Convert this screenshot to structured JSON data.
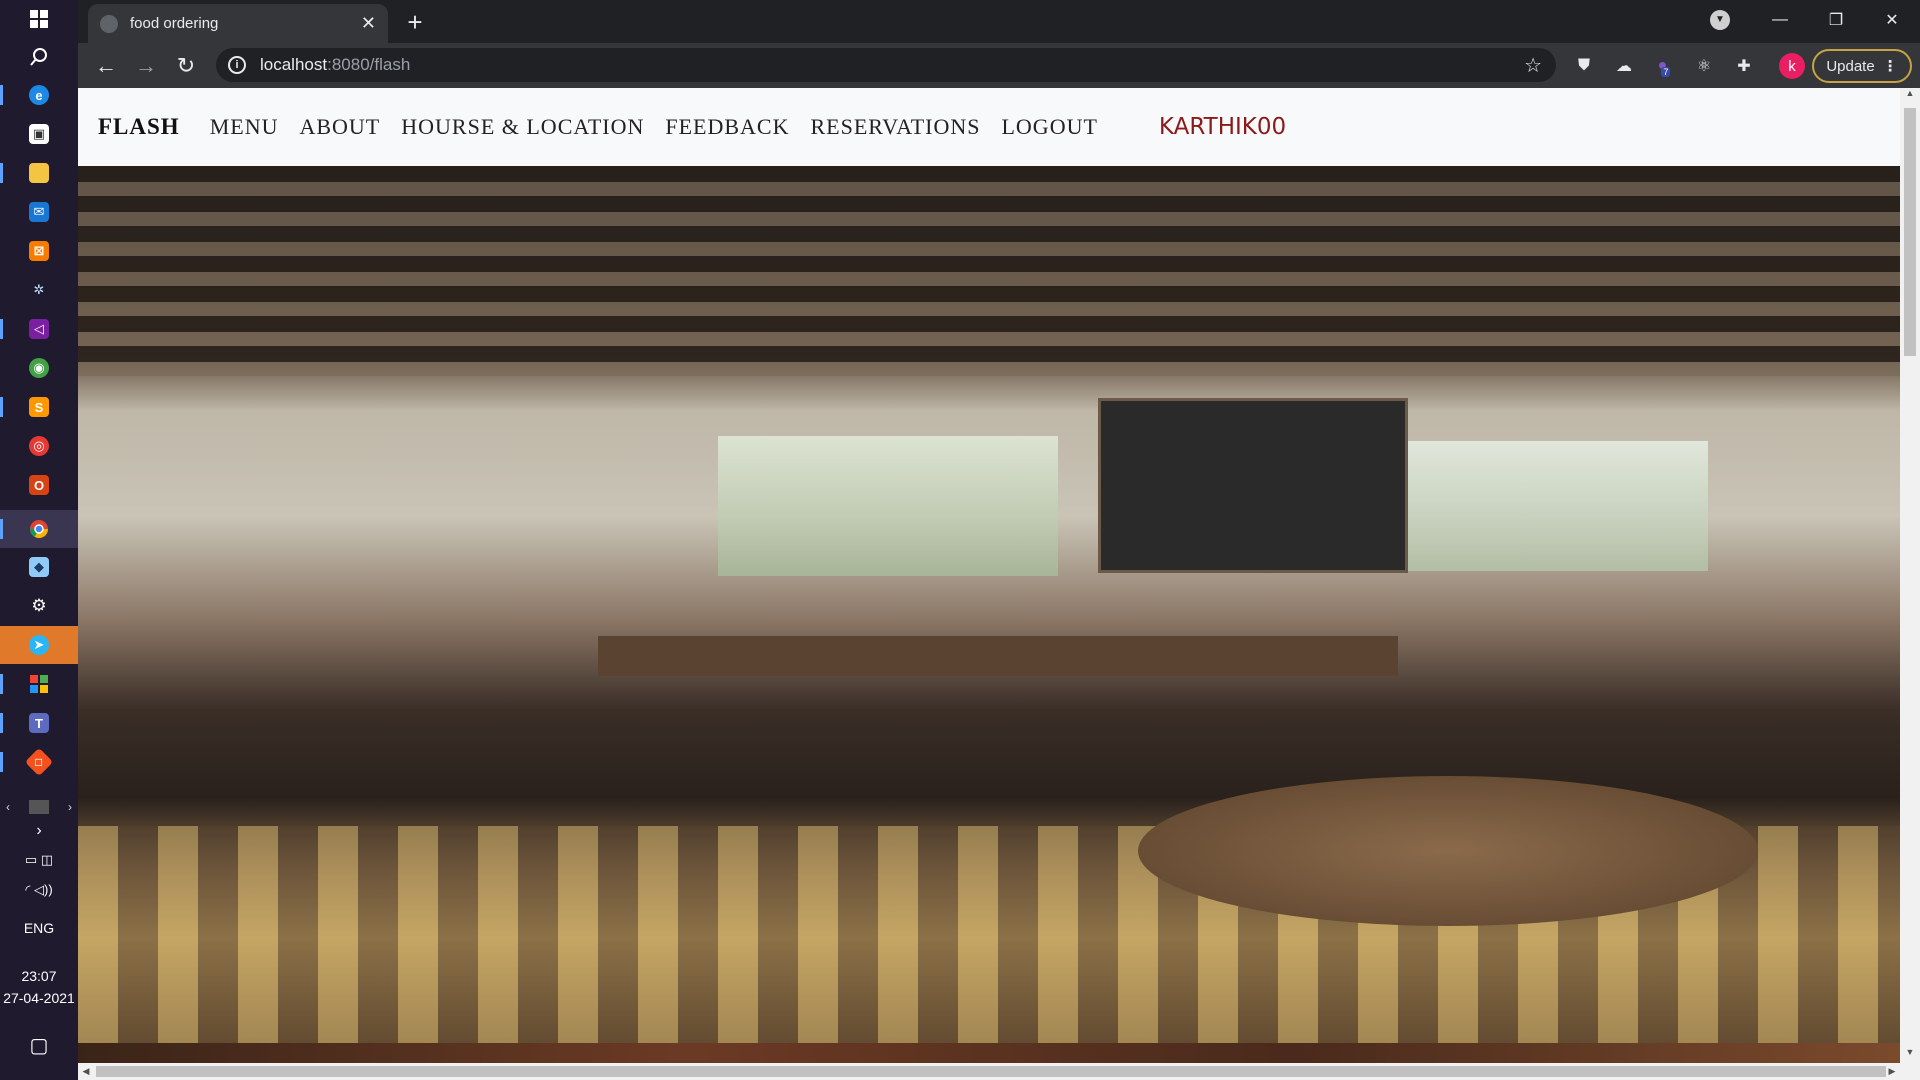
{
  "browser": {
    "tab_title": "food ordering",
    "new_tab_label": "+",
    "url_host": "localhost",
    "url_path": ":8080/flash",
    "profile_initial": "k",
    "update_label": "Update",
    "extension_badge": "7"
  },
  "site": {
    "brand": "FLASH",
    "nav": [
      "MENU",
      "ABOUT",
      "HOURSE & LOCATION",
      "FEEDBACK",
      "RESERVATIONS",
      "LOGOUT"
    ],
    "user": "KARTHIK00"
  },
  "system": {
    "language": "ENG",
    "time": "23:07",
    "date": "27-04-2021"
  },
  "icons": {
    "taskbar": [
      "windows-start-icon",
      "search-icon",
      "edge-icon",
      "store-icon",
      "file-explorer-icon",
      "mail-icon",
      "xampp-icon",
      "settings-gear-icon",
      "visual-studio-icon",
      "android-studio-icon",
      "sublime-icon",
      "app-red-icon",
      "office-icon",
      "chrome-icon",
      "app-blue-icon",
      "settings-icon",
      "telegram-icon",
      "photos-icon",
      "teams-icon",
      "git-icon"
    ]
  },
  "colors": {
    "user_accent": "#8b1a1a",
    "chrome_dark": "#202124",
    "update_border": "#c6a443",
    "avatar_bg": "#e91e63"
  }
}
